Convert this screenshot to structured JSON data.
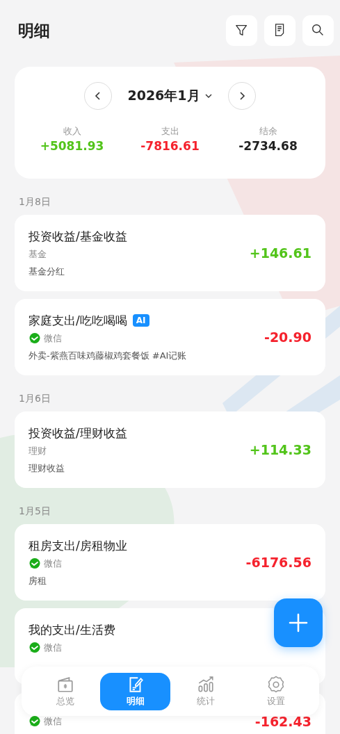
{
  "header": {
    "title": "明细",
    "actions": [
      {
        "kind": "filter"
      },
      {
        "kind": "document"
      },
      {
        "kind": "search"
      }
    ]
  },
  "summary": {
    "month": "2026年1月",
    "stats": [
      {
        "label": "收入",
        "value": "+5081.93",
        "kind": "income"
      },
      {
        "label": "支出",
        "value": "-7816.61",
        "kind": "expense"
      },
      {
        "label": "结余",
        "value": "-2734.68",
        "kind": "balance"
      }
    ]
  },
  "groups": [
    {
      "date": "1月8日",
      "entries": [
        {
          "category": "投资收益/基金收益",
          "account": "基金",
          "account_icon": false,
          "note": "基金分红",
          "amount": "+146.61",
          "kind": "income",
          "ai": false
        }
      ]
    },
    {
      "entries": [
        {
          "category": "家庭支出/吃吃喝喝",
          "account": "微信",
          "account_icon": true,
          "note": "外卖-紫燕百味鸡藤椒鸡套餐饭 #AI记账",
          "amount": "-20.90",
          "kind": "expense",
          "ai": true,
          "ai_label": "AI"
        }
      ]
    },
    {
      "date": "1月6日",
      "entries": [
        {
          "category": "投资收益/理财收益",
          "account": "理财",
          "account_icon": false,
          "note": "理财收益",
          "amount": "+114.33",
          "kind": "income",
          "ai": false
        }
      ]
    },
    {
      "date": "1月5日",
      "entries": [
        {
          "category": "租房支出/房租物业",
          "account": "微信",
          "account_icon": true,
          "note": "房租",
          "amount": "-6176.56",
          "kind": "expense",
          "ai": false
        },
        {
          "category": "我的支出/生活费",
          "account": "微信",
          "account_icon": true,
          "ai": false
        },
        {
          "account": "微信",
          "account_icon": true,
          "amount": "-162.43",
          "kind": "expense",
          "ai": false
        }
      ]
    }
  ],
  "nav": [
    {
      "label": "总览",
      "kind": "wallet",
      "selected": false
    },
    {
      "label": "明细",
      "kind": "note",
      "selected": true
    },
    {
      "label": "统计",
      "kind": "chart",
      "selected": false
    },
    {
      "label": "设置",
      "kind": "gear",
      "selected": false
    }
  ]
}
